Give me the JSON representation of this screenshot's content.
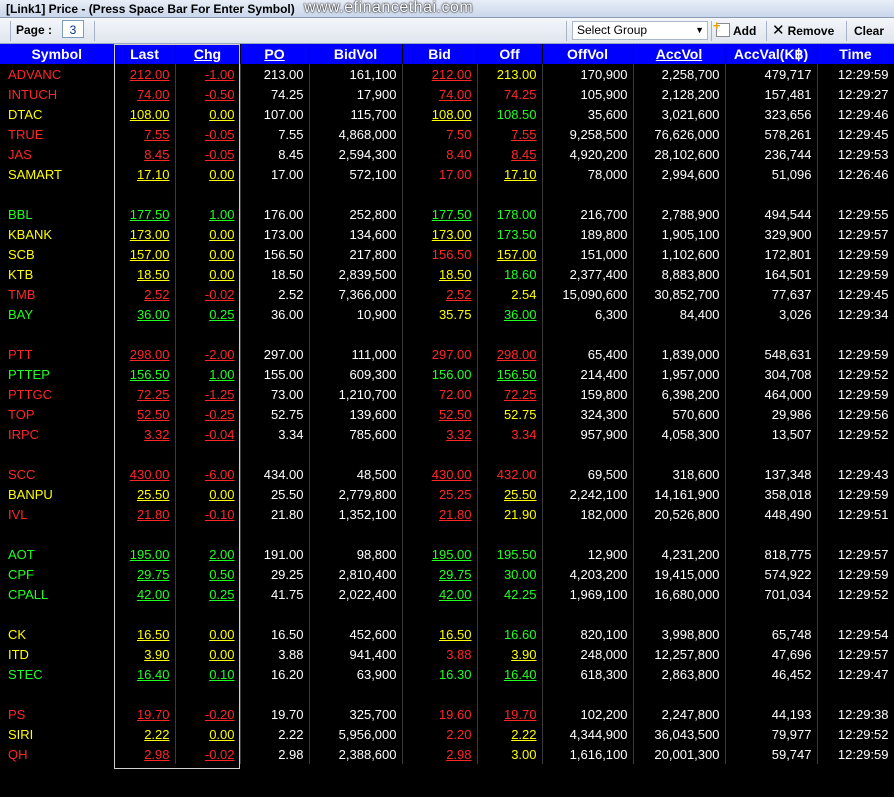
{
  "window": {
    "title": "[Link1] Price  - (Press Space Bar For Enter Symbol)",
    "watermark": "www.efinancethai.com"
  },
  "toolbar": {
    "page_label": "Page :",
    "page_value": "3",
    "group_placeholder": "Select Group",
    "add_label": "Add",
    "remove_label": "Remove",
    "clear_label": "Clear"
  },
  "columns": [
    "Symbol",
    "Last",
    "Chg",
    "PO",
    "BidVol",
    "Bid",
    "Off",
    "OffVol",
    "AccVol",
    "AccVal(K฿)",
    "Time"
  ],
  "colors": {
    "up": "#22ff22",
    "down": "#ff2626",
    "unchanged": "#ffff00",
    "header": "#0000ff"
  },
  "rows": [
    [
      "ADVANC",
      "212.00",
      "-1.00",
      "213.00",
      "161,100",
      "212.00",
      "213.00",
      "170,900",
      "2,258,700",
      "479,717",
      "12:29:59",
      "d",
      "d",
      "u"
    ],
    [
      "INTUCH",
      "74.00",
      "-0.50",
      "74.25",
      "17,900",
      "74.00",
      "74.25",
      "105,900",
      "2,128,200",
      "157,481",
      "12:29:27",
      "d",
      "d",
      "d"
    ],
    [
      "DTAC",
      "108.00",
      "0.00",
      "107.00",
      "115,700",
      "108.00",
      "108.50",
      "35,600",
      "3,021,600",
      "323,656",
      "12:29:46",
      "u",
      "u",
      "g"
    ],
    [
      "TRUE",
      "7.55",
      "-0.05",
      "7.55",
      "4,868,000",
      "7.50",
      "7.55",
      "9,258,500",
      "76,626,000",
      "578,261",
      "12:29:45",
      "d",
      "d",
      "d"
    ],
    [
      "JAS",
      "8.45",
      "-0.05",
      "8.45",
      "2,594,300",
      "8.40",
      "8.45",
      "4,920,200",
      "28,102,600",
      "236,744",
      "12:29:53",
      "d",
      "d",
      "d"
    ],
    [
      "SAMART",
      "17.10",
      "0.00",
      "17.00",
      "572,100",
      "17.00",
      "17.10",
      "78,000",
      "2,994,600",
      "51,096",
      "12:26:46",
      "u",
      "d",
      "u"
    ],
    null,
    [
      "BBL",
      "177.50",
      "1.00",
      "176.00",
      "252,800",
      "177.50",
      "178.00",
      "216,700",
      "2,788,900",
      "494,544",
      "12:29:55",
      "g",
      "g",
      "g"
    ],
    [
      "KBANK",
      "173.00",
      "0.00",
      "173.00",
      "134,600",
      "173.00",
      "173.50",
      "189,800",
      "1,905,100",
      "329,900",
      "12:29:57",
      "u",
      "u",
      "g"
    ],
    [
      "SCB",
      "157.00",
      "0.00",
      "156.50",
      "217,800",
      "156.50",
      "157.00",
      "151,000",
      "1,102,600",
      "172,801",
      "12:29:59",
      "u",
      "d",
      "u"
    ],
    [
      "KTB",
      "18.50",
      "0.00",
      "18.50",
      "2,839,500",
      "18.50",
      "18.60",
      "2,377,400",
      "8,883,800",
      "164,501",
      "12:29:59",
      "u",
      "u",
      "g"
    ],
    [
      "TMB",
      "2.52",
      "-0.02",
      "2.52",
      "7,366,000",
      "2.52",
      "2.54",
      "15,090,600",
      "30,852,700",
      "77,637",
      "12:29:45",
      "d",
      "d",
      "u"
    ],
    [
      "BAY",
      "36.00",
      "0.25",
      "36.00",
      "10,900",
      "35.75",
      "36.00",
      "6,300",
      "84,400",
      "3,026",
      "12:29:34",
      "g",
      "u",
      "g"
    ],
    null,
    [
      "PTT",
      "298.00",
      "-2.00",
      "297.00",
      "111,000",
      "297.00",
      "298.00",
      "65,400",
      "1,839,000",
      "548,631",
      "12:29:59",
      "d",
      "d",
      "d"
    ],
    [
      "PTTEP",
      "156.50",
      "1.00",
      "155.00",
      "609,300",
      "156.00",
      "156.50",
      "214,400",
      "1,957,000",
      "304,708",
      "12:29:52",
      "g",
      "g",
      "g"
    ],
    [
      "PTTGC",
      "72.25",
      "-1.25",
      "73.00",
      "1,210,700",
      "72.00",
      "72.25",
      "159,800",
      "6,398,200",
      "464,000",
      "12:29:59",
      "d",
      "d",
      "d"
    ],
    [
      "TOP",
      "52.50",
      "-0.25",
      "52.75",
      "139,600",
      "52.50",
      "52.75",
      "324,300",
      "570,600",
      "29,986",
      "12:29:56",
      "d",
      "d",
      "u"
    ],
    [
      "IRPC",
      "3.32",
      "-0.04",
      "3.34",
      "785,600",
      "3.32",
      "3.34",
      "957,900",
      "4,058,300",
      "13,507",
      "12:29:52",
      "d",
      "d",
      "d"
    ],
    null,
    [
      "SCC",
      "430.00",
      "-6.00",
      "434.00",
      "48,500",
      "430.00",
      "432.00",
      "69,500",
      "318,600",
      "137,348",
      "12:29:43",
      "d",
      "d",
      "d"
    ],
    [
      "BANPU",
      "25.50",
      "0.00",
      "25.50",
      "2,779,800",
      "25.25",
      "25.50",
      "2,242,100",
      "14,161,900",
      "358,018",
      "12:29:59",
      "u",
      "d",
      "u"
    ],
    [
      "IVL",
      "21.80",
      "-0.10",
      "21.80",
      "1,352,100",
      "21.80",
      "21.90",
      "182,000",
      "20,526,800",
      "448,490",
      "12:29:51",
      "d",
      "d",
      "u"
    ],
    null,
    [
      "AOT",
      "195.00",
      "2.00",
      "191.00",
      "98,800",
      "195.00",
      "195.50",
      "12,900",
      "4,231,200",
      "818,775",
      "12:29:57",
      "g",
      "g",
      "g"
    ],
    [
      "CPF",
      "29.75",
      "0.50",
      "29.25",
      "2,810,400",
      "29.75",
      "30.00",
      "4,203,200",
      "19,415,000",
      "574,922",
      "12:29:59",
      "g",
      "g",
      "g"
    ],
    [
      "CPALL",
      "42.00",
      "0.25",
      "41.75",
      "2,022,400",
      "42.00",
      "42.25",
      "1,969,100",
      "16,680,000",
      "701,034",
      "12:29:52",
      "g",
      "g",
      "g"
    ],
    null,
    [
      "CK",
      "16.50",
      "0.00",
      "16.50",
      "452,600",
      "16.50",
      "16.60",
      "820,100",
      "3,998,800",
      "65,748",
      "12:29:54",
      "u",
      "u",
      "g"
    ],
    [
      "ITD",
      "3.90",
      "0.00",
      "3.88",
      "941,400",
      "3.88",
      "3.90",
      "248,000",
      "12,257,800",
      "47,696",
      "12:29:57",
      "u",
      "d",
      "u"
    ],
    [
      "STEC",
      "16.40",
      "0.10",
      "16.20",
      "63,900",
      "16.30",
      "16.40",
      "618,300",
      "2,863,800",
      "46,452",
      "12:29:47",
      "g",
      "g",
      "g"
    ],
    null,
    [
      "PS",
      "19.70",
      "-0.20",
      "19.70",
      "325,700",
      "19.60",
      "19.70",
      "102,200",
      "2,247,800",
      "44,193",
      "12:29:38",
      "d",
      "d",
      "d"
    ],
    [
      "SIRI",
      "2.22",
      "0.00",
      "2.22",
      "5,956,000",
      "2.20",
      "2.22",
      "4,344,900",
      "36,043,500",
      "79,977",
      "12:29:52",
      "u",
      "d",
      "u"
    ],
    [
      "QH",
      "2.98",
      "-0.02",
      "2.98",
      "2,388,600",
      "2.98",
      "3.00",
      "1,616,100",
      "20,001,300",
      "59,747",
      "12:29:59",
      "d",
      "d",
      "u"
    ]
  ]
}
